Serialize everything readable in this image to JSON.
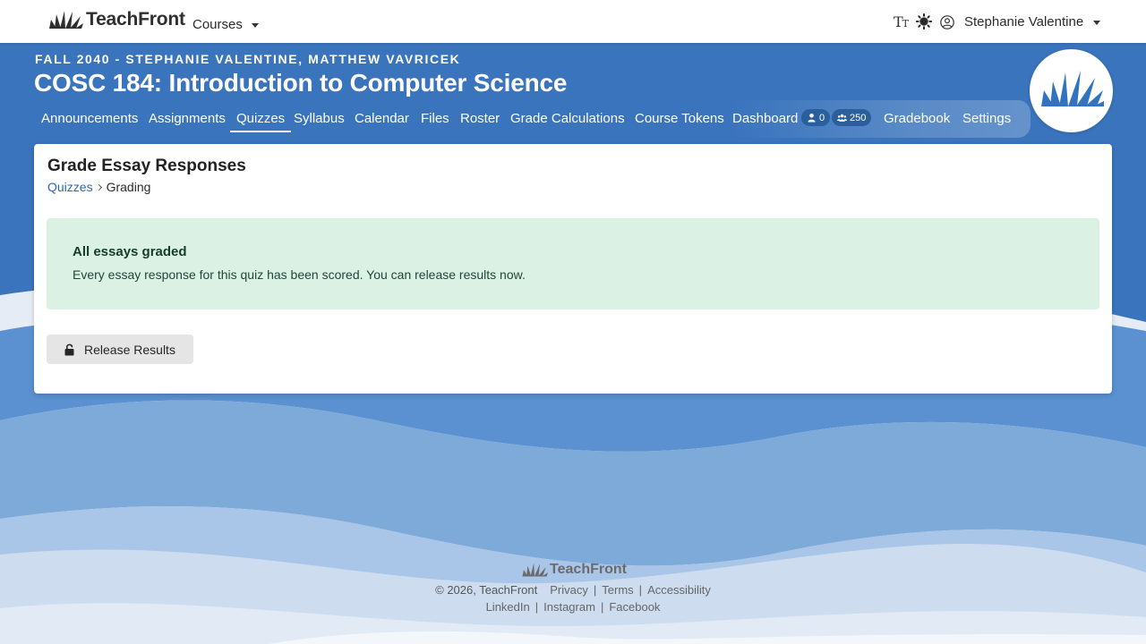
{
  "app": {
    "brand_name": "TeachFront",
    "courses_label": "Courses",
    "text_size_label": "TT",
    "user_name": "Stephanie Valentine"
  },
  "course": {
    "term_line": "FALL 2040 - STEPHANIE VALENTINE, MATTHEW VAVRICEK",
    "title": "COSC 184: Introduction to Computer Science",
    "tabs": [
      {
        "label": "Announcements"
      },
      {
        "label": "Assignments"
      },
      {
        "label": "Quizzes",
        "active": true
      },
      {
        "label": "Syllabus"
      },
      {
        "label": "Calendar"
      },
      {
        "label": "Files"
      },
      {
        "label": "Roster"
      },
      {
        "label": "Grade Calculations"
      },
      {
        "label": "Course Tokens"
      },
      {
        "label": "Dashboard"
      },
      {
        "label": "Gradebook"
      },
      {
        "label": "Settings"
      }
    ],
    "online_count": "0",
    "enrolled_count": "250"
  },
  "page": {
    "title": "Grade Essay Responses",
    "breadcrumb": {
      "parent": "Quizzes",
      "current": "Grading"
    },
    "alert": {
      "title": "All essays graded",
      "message": "Every essay response for this quiz has been scored. You can release results now."
    },
    "release_button": "Release Results"
  },
  "footer": {
    "brand": "TeachFront",
    "copyright": "© 2026, TeachFront",
    "links": [
      "Privacy",
      "Terms",
      "Accessibility"
    ],
    "social": [
      "LinkedIn",
      "Instagram",
      "Facebook"
    ]
  },
  "colors": {
    "header_blue": "#2f6db5",
    "link_blue": "#2e66b3",
    "alert_bg": "#dbf1e4",
    "button_bg": "#e5e5e5"
  }
}
